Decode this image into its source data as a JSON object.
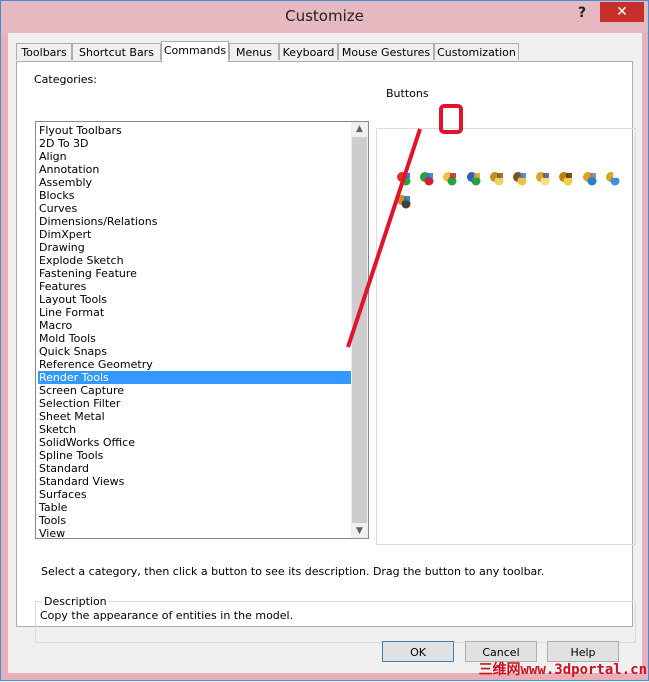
{
  "window": {
    "title": "Customize",
    "help_glyph": "?",
    "close_glyph": "✕"
  },
  "tabs": [
    {
      "label": "Toolbars"
    },
    {
      "label": "Shortcut Bars"
    },
    {
      "label": "Commands"
    },
    {
      "label": "Menus"
    },
    {
      "label": "Keyboard"
    },
    {
      "label": "Mouse Gestures"
    },
    {
      "label": "Customization"
    }
  ],
  "active_tab": "Commands",
  "categories": {
    "label": "Categories:",
    "items": [
      "Flyout Toolbars",
      "2D To 3D",
      "Align",
      "Annotation",
      "Assembly",
      "Blocks",
      "Curves",
      "Dimensions/Relations",
      "DimXpert",
      "Drawing",
      "Explode Sketch",
      "Fastening Feature",
      "Features",
      "Layout Tools",
      "Line Format",
      "Macro",
      "Mold Tools",
      "Quick Snaps",
      "Reference Geometry",
      "Render Tools",
      "Screen Capture",
      "Selection Filter",
      "Sheet Metal",
      "Sketch",
      "SolidWorks Office",
      "Spline Tools",
      "Standard",
      "Standard Views",
      "Surfaces",
      "Table",
      "Tools",
      "View"
    ],
    "selected": "Render Tools",
    "scroll_up_glyph": "▲",
    "scroll_down_glyph": "▼"
  },
  "buttons": {
    "label": "Buttons",
    "icons": [
      "appearance-sphere-icon",
      "copy-appearance-icon",
      "paste-appearance-icon",
      "scene-icon",
      "decal-icon",
      "render-preview-icon",
      "render-region-icon",
      "light-icon",
      "render-options-icon",
      "schedule-render-icon",
      "final-render-icon"
    ],
    "highlighted_index": 2
  },
  "instruction": "Select a category, then click a button to see its description. Drag the button to any toolbar.",
  "description": {
    "label": "Description",
    "text": "Copy the appearance of entities in the model."
  },
  "dialog_buttons": {
    "ok": "OK",
    "cancel": "Cancel",
    "help": "Help"
  },
  "watermark": "三维网www.3dportal.cn",
  "colors": {
    "selection": "#3399ff",
    "annotation": "#e0142a",
    "close": "#c7302a"
  }
}
